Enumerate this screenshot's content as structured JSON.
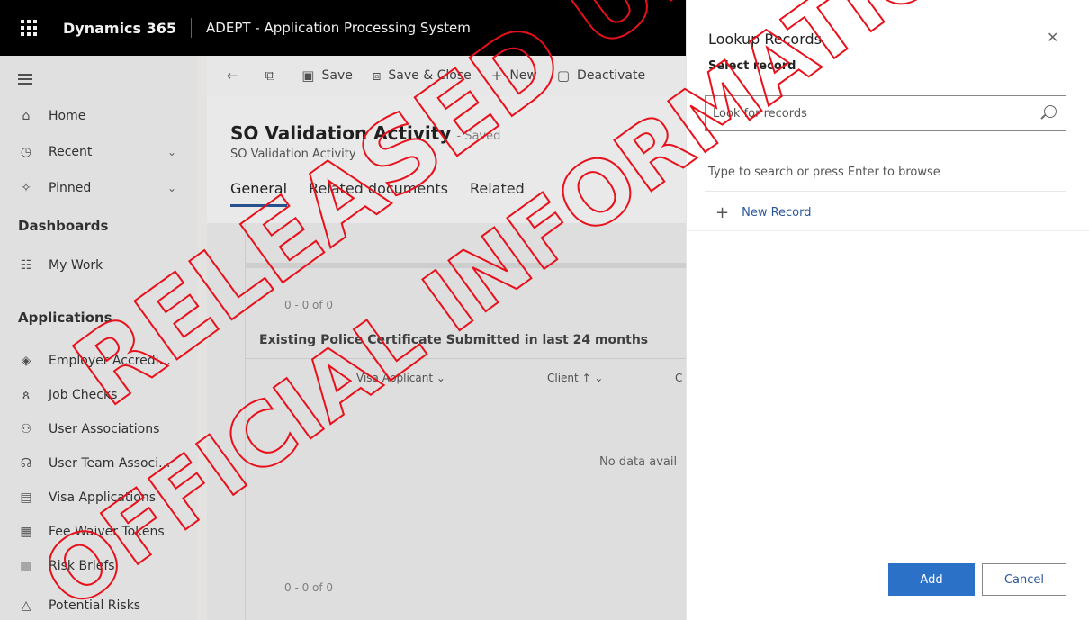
{
  "topbar": {
    "brand": "Dynamics 365",
    "app_name": "ADEPT - Application Processing System"
  },
  "nav": {
    "home": "Home",
    "recent": "Recent",
    "pinned": "Pinned",
    "dashboards_header": "Dashboards",
    "my_work": "My Work",
    "applications_header": "Applications",
    "items": [
      {
        "label": "Employer Accredi...",
        "icon": "badge-icon"
      },
      {
        "label": "Job Checks",
        "icon": "people-icon"
      },
      {
        "label": "User Associations",
        "icon": "user-link-icon"
      },
      {
        "label": "User Team Associ...",
        "icon": "org-icon"
      },
      {
        "label": "Visa Applications",
        "icon": "document-icon"
      },
      {
        "label": "Fee Waiver Tokens",
        "icon": "token-icon"
      },
      {
        "label": "Risk Briefs",
        "icon": "brief-icon"
      },
      {
        "label": "Potential Risks",
        "icon": "warning-icon"
      }
    ]
  },
  "commandbar": {
    "save": "Save",
    "save_close": "Save & Close",
    "new": "New",
    "deactivate": "Deactivate"
  },
  "form": {
    "title": "SO Validation Activity",
    "status": "- Saved",
    "subtitle": "SO Validation Activity",
    "tabs": [
      "General",
      "Related documents",
      "Related"
    ],
    "count_top": "0 - 0 of 0",
    "section_title": "Existing Police Certificate Submitted in last 24 months",
    "columns": [
      "Visa Applicant",
      "Client",
      "C"
    ],
    "no_data": "No data avail",
    "count_bottom": "0 - 0 of 0"
  },
  "dialog": {
    "title": "Lookup Records",
    "subtitle": "Select record",
    "search_placeholder": "Look for records",
    "hint": "Type to search or press Enter to browse",
    "new_record": "New Record",
    "add": "Add",
    "cancel": "Cancel"
  },
  "watermark": {
    "line1": "RELEASED UNDER THE",
    "line2": "OFFICIAL INFORMATION ACT",
    "color": "#e8101a"
  }
}
